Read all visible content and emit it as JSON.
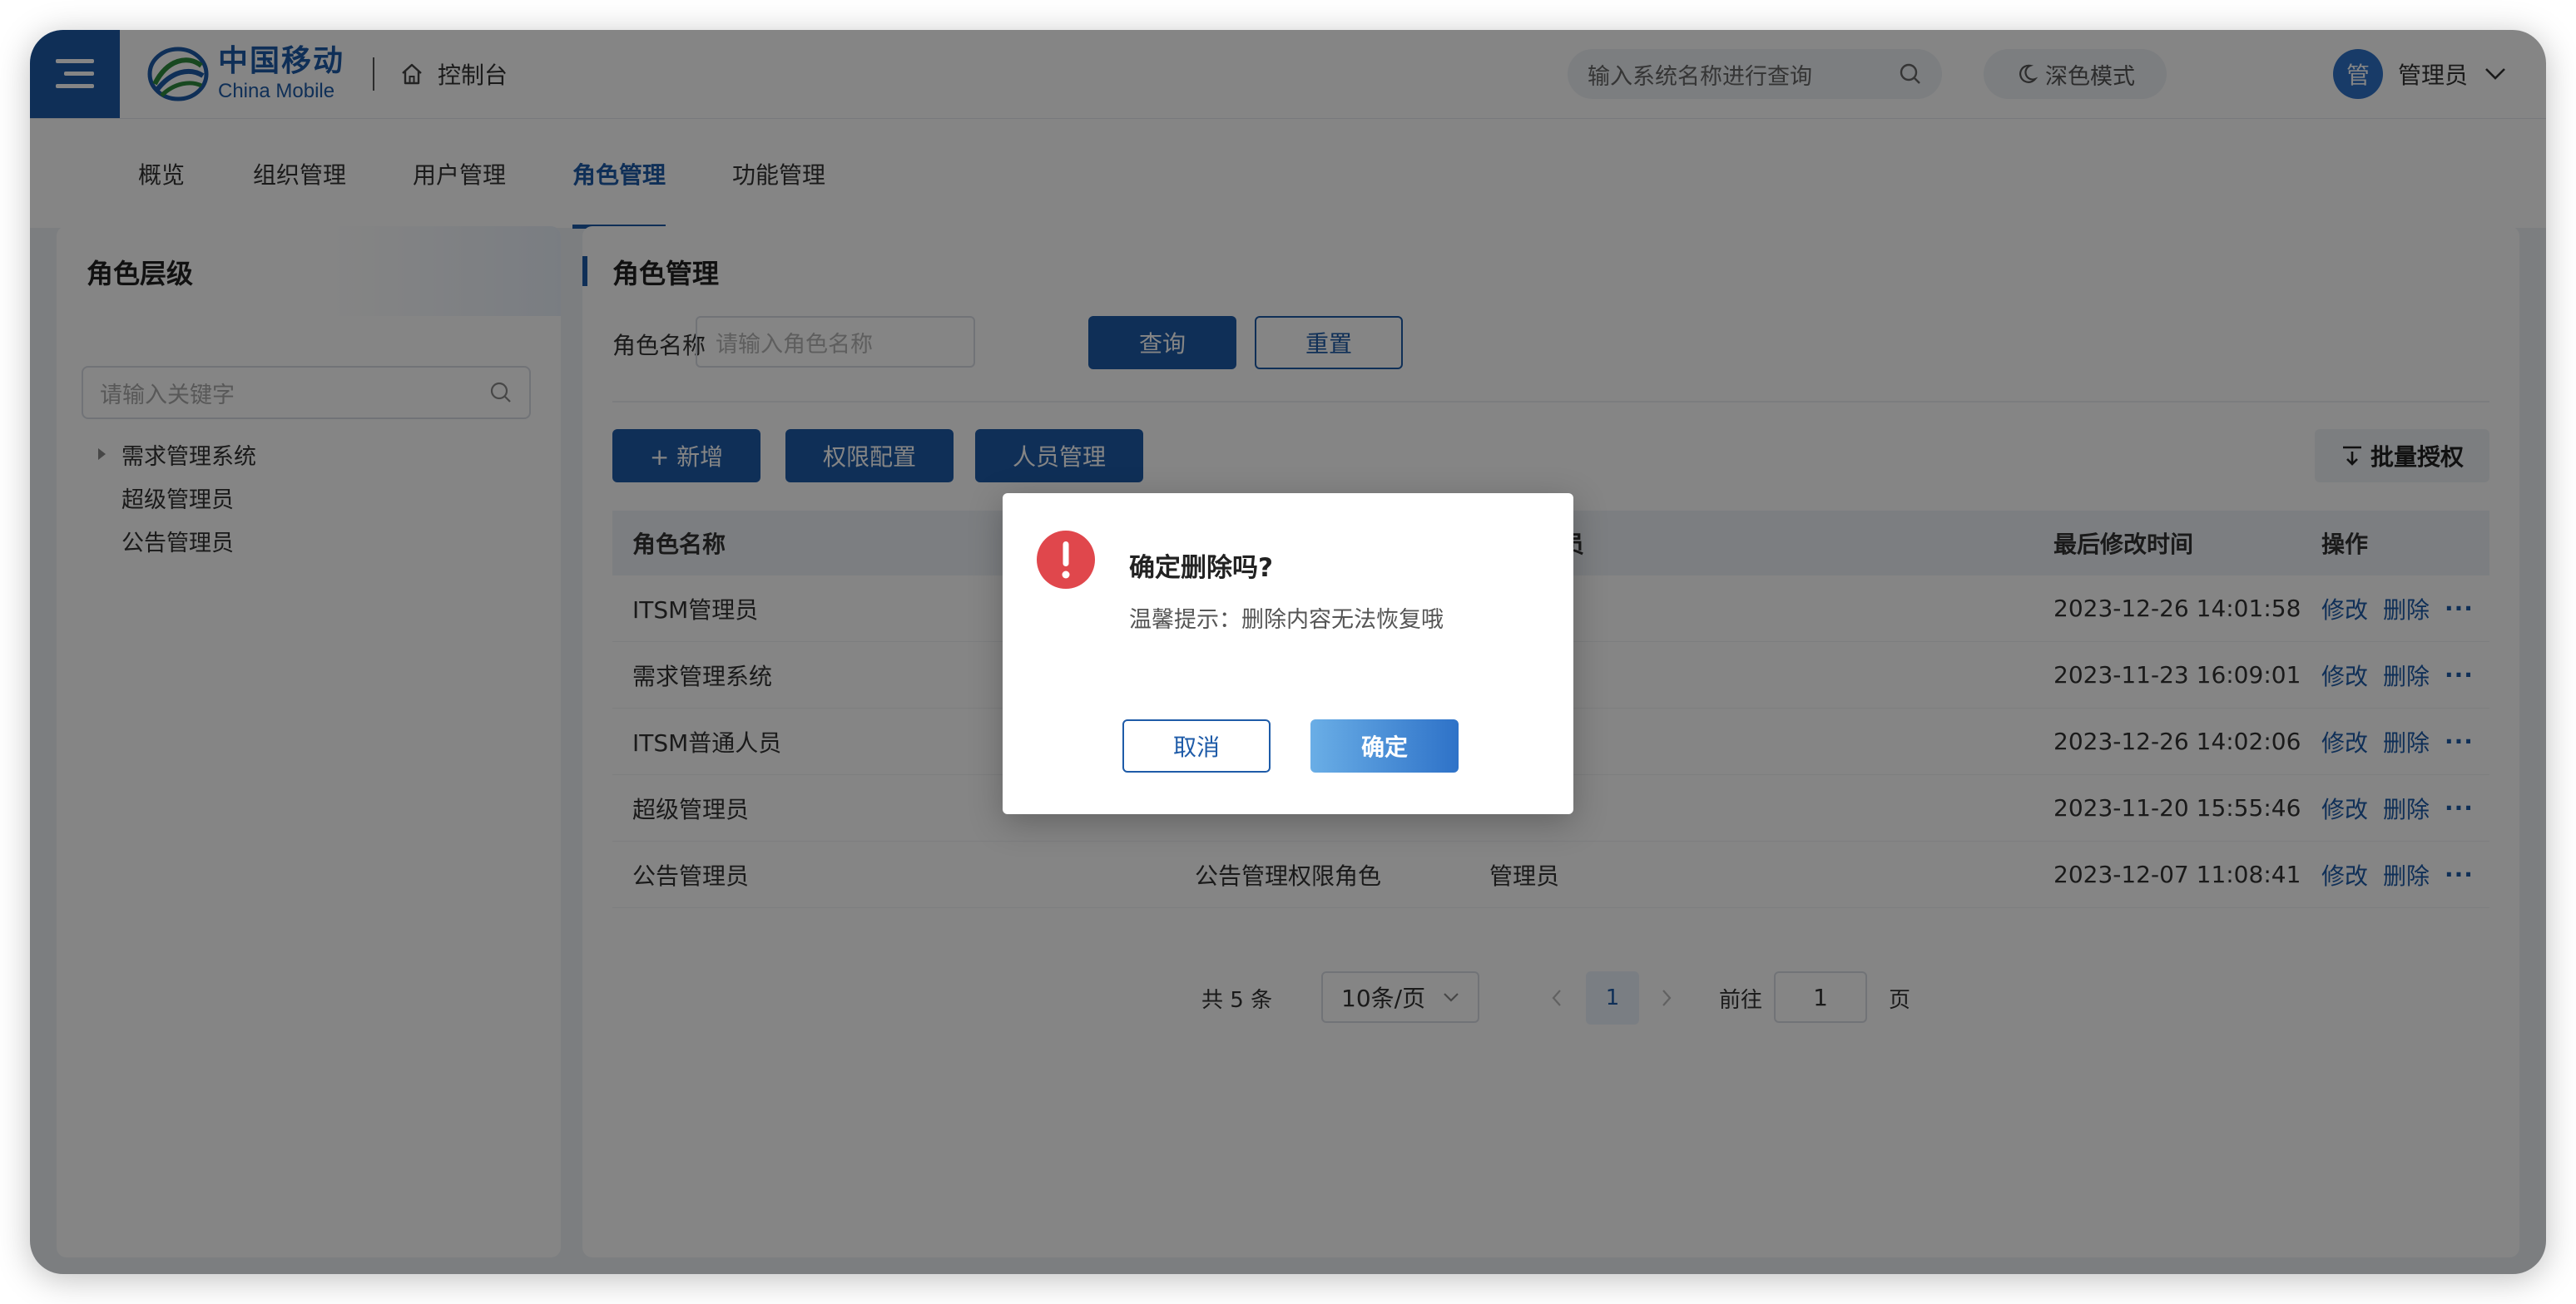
{
  "header": {
    "logo_cn": "中国移动",
    "logo_en": "China Mobile",
    "home_label": "控制台",
    "search_placeholder": "输入系统名称进行查询",
    "dark_mode_label": "深色模式",
    "user_avatar_char": "管",
    "user_name": "管理员"
  },
  "tabs": [
    {
      "label": "概览"
    },
    {
      "label": "组织管理"
    },
    {
      "label": "用户管理"
    },
    {
      "label": "角色管理",
      "active": true
    },
    {
      "label": "功能管理"
    }
  ],
  "sidebar": {
    "title": "角色层级",
    "search_placeholder": "请输入关键字",
    "tree": [
      {
        "label": "需求管理系统",
        "collapsible": true
      },
      {
        "label": "超级管理员"
      },
      {
        "label": "公告管理员"
      }
    ]
  },
  "main": {
    "title": "角色管理",
    "filter_label": "角色名称",
    "filter_placeholder": "请输入角色名称",
    "query_button": "查询",
    "reset_button": "重置",
    "add_button": "+ 新增",
    "permission_button": "权限配置",
    "staff_button": "人员管理",
    "batch_button": "批量授权"
  },
  "table": {
    "columns": {
      "name": "角色名称",
      "assigned": "人员",
      "modified": "最后修改时间",
      "ops": "操作"
    },
    "rows": [
      {
        "name": "ITSM管理员",
        "desc": "",
        "assigned": "",
        "modified": "2023-12-26 14:01:58"
      },
      {
        "name": "需求管理系统",
        "desc": "",
        "assigned": "",
        "modified": "2023-11-23 16:09:01"
      },
      {
        "name": "ITSM普通人员",
        "desc": "",
        "assigned": "",
        "modified": "2023-12-26 14:02:06"
      },
      {
        "name": "超级管理员",
        "desc": "",
        "assigned": "",
        "modified": "2023-11-20 15:55:46"
      },
      {
        "name": "公告管理员",
        "desc": "公告管理权限角色",
        "assigned": "管理员",
        "modified": "2023-12-07 11:08:41"
      }
    ],
    "op_edit": "修改",
    "op_delete": "删除",
    "op_more": "···"
  },
  "pagination": {
    "total_text": "共 5 条",
    "page_size": "10条/页",
    "current_page": "1",
    "goto_label": "前往",
    "goto_value": "1",
    "page_unit": "页"
  },
  "modal": {
    "title": "确定删除吗?",
    "description": "温馨提示：删除内容无法恢复哦",
    "cancel_label": "取消",
    "confirm_label": "确定"
  },
  "colors": {
    "brand": "#1e5ba8",
    "warning": "#e0474c",
    "overlay": "rgba(0,0,0,0.48)"
  }
}
